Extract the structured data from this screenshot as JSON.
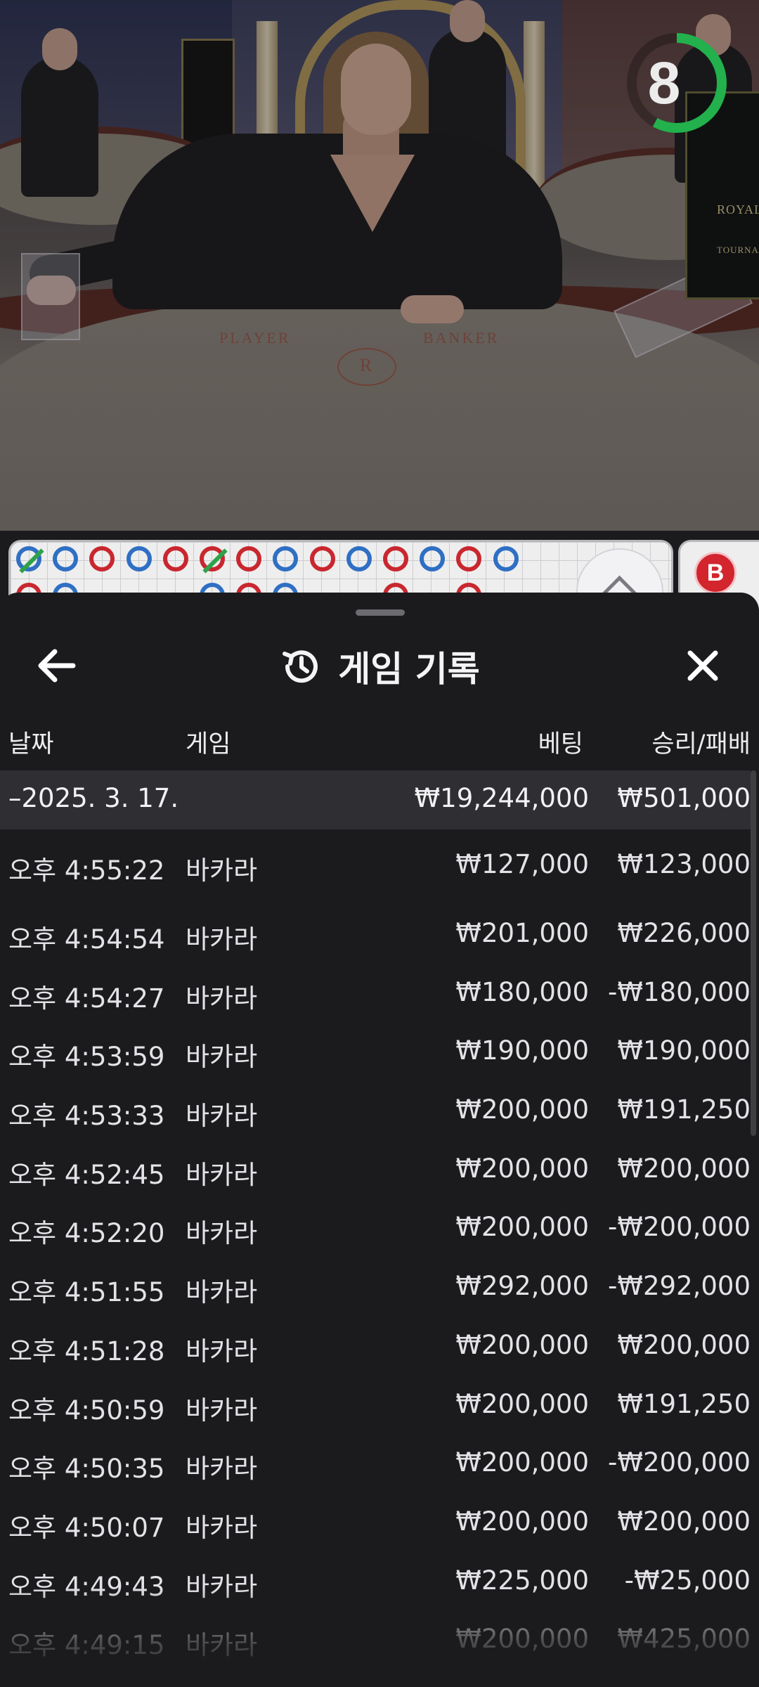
{
  "video": {
    "table_labels": {
      "player": "PLAYER",
      "banker": "BANKER"
    },
    "sign_text": {
      "line1": "ROYAL",
      "line2": "TOURNA"
    },
    "countdown": "8",
    "countdown_fraction": 0.58
  },
  "roadmap": {
    "row1": [
      "P-tie",
      "P",
      "B",
      "P",
      "B",
      "B-tie",
      "B",
      "P",
      "B",
      "P",
      "B",
      "P",
      "B",
      "P"
    ],
    "mini_badge": "B"
  },
  "history": {
    "title": "게임 기록",
    "icons": {
      "back": "arrow-left-icon",
      "title": "history-icon",
      "close": "close-icon"
    },
    "columns": {
      "date": "날짜",
      "game": "게임",
      "bet": "베팅",
      "win_loss": "승리/패배"
    },
    "day_group": {
      "date": "–2025. 3. 17.",
      "bet_total": "₩19,244,000",
      "win_total": "₩501,000"
    },
    "rows": [
      {
        "time": "오후 4:55:22",
        "game": "바카라",
        "bet": "₩127,000",
        "result": "₩123,000"
      },
      {
        "time": "오후 4:54:54",
        "game": "바카라",
        "bet": "₩201,000",
        "result": "₩226,000"
      },
      {
        "time": "오후 4:54:27",
        "game": "바카라",
        "bet": "₩180,000",
        "result": "-₩180,000"
      },
      {
        "time": "오후 4:53:59",
        "game": "바카라",
        "bet": "₩190,000",
        "result": "₩190,000"
      },
      {
        "time": "오후 4:53:33",
        "game": "바카라",
        "bet": "₩200,000",
        "result": "₩191,250"
      },
      {
        "time": "오후 4:52:45",
        "game": "바카라",
        "bet": "₩200,000",
        "result": "₩200,000"
      },
      {
        "time": "오후 4:52:20",
        "game": "바카라",
        "bet": "₩200,000",
        "result": "-₩200,000"
      },
      {
        "time": "오후 4:51:55",
        "game": "바카라",
        "bet": "₩292,000",
        "result": "-₩292,000"
      },
      {
        "time": "오후 4:51:28",
        "game": "바카라",
        "bet": "₩200,000",
        "result": "₩200,000"
      },
      {
        "time": "오후 4:50:59",
        "game": "바카라",
        "bet": "₩200,000",
        "result": "₩191,250"
      },
      {
        "time": "오후 4:50:35",
        "game": "바카라",
        "bet": "₩200,000",
        "result": "-₩200,000"
      },
      {
        "time": "오후 4:50:07",
        "game": "바카라",
        "bet": "₩200,000",
        "result": "₩200,000"
      },
      {
        "time": "오후 4:49:43",
        "game": "바카라",
        "bet": "₩225,000",
        "result": "-₩25,000"
      },
      {
        "time": "오후 4:49:15",
        "game": "바카라",
        "bet": "₩200,000",
        "result": "₩425,000"
      }
    ]
  },
  "colors": {
    "timer_ring": "#22b14c",
    "banker_red": "#c9272f",
    "player_blue": "#2f6fc4",
    "tie_green": "#2ea24a",
    "sheet_bg": "#1b1b1e",
    "day_row_bg": "#2f2f33"
  }
}
